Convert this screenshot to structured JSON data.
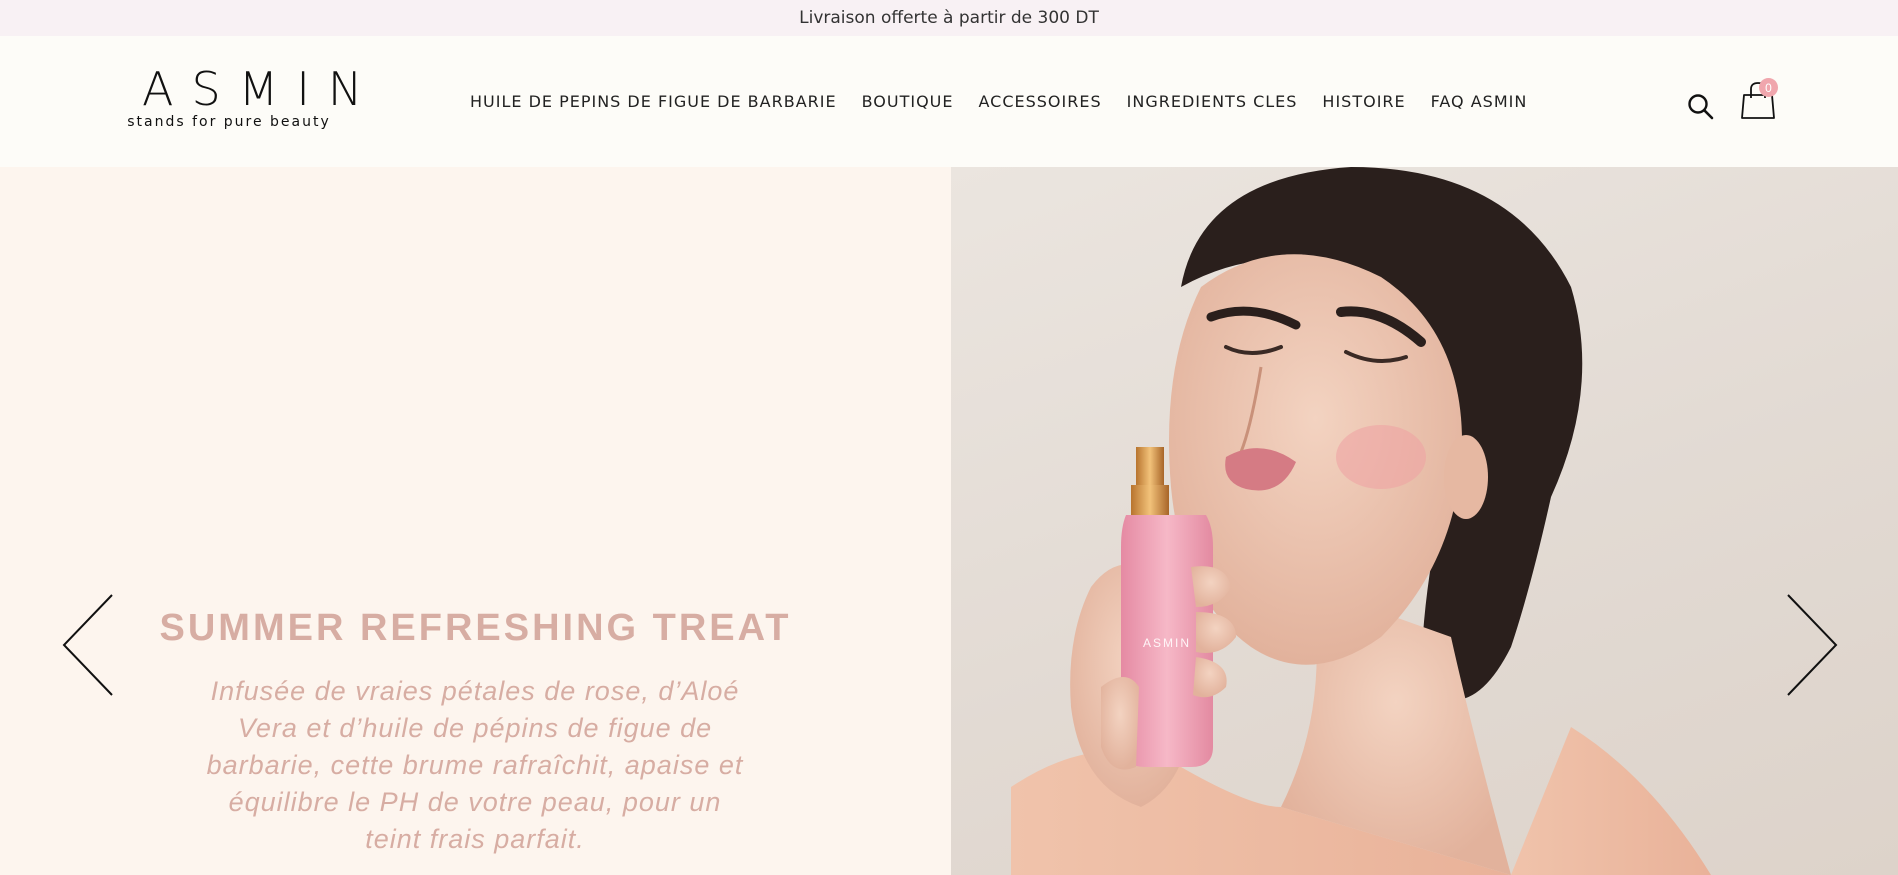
{
  "announcement": {
    "text": "Livraison offerte à partir de 300 DT"
  },
  "header": {
    "logo": {
      "word": "ASMIN",
      "tagline": "stands for pure beauty"
    },
    "nav": [
      {
        "label": "HUILE DE PEPINS DE FIGUE DE BARBARIE"
      },
      {
        "label": "BOUTIQUE"
      },
      {
        "label": "ACCESSOIRES"
      },
      {
        "label": "INGREDIENTS CLES"
      },
      {
        "label": "HISTOIRE"
      },
      {
        "label": "FAQ ASMIN"
      }
    ],
    "search_icon": "search-icon",
    "cart": {
      "icon": "shopping-bag-icon",
      "count": "0"
    }
  },
  "hero": {
    "title": "SUMMER REFRESHING TREAT",
    "text": "Infusée de vraies pétales de rose, d’Aloé Vera et d’huile de pépins de figue de barbarie, cette brume rafraîchit, apaise et équilibre le PH de votre peau, pour un teint frais parfait.",
    "bottle_label": "ASMIN",
    "prev_icon": "chevron-left-icon",
    "next_icon": "chevron-right-icon"
  },
  "colors": {
    "announcement_bg": "#f8f1f4",
    "hero_left_bg": "#fdf5ee",
    "hero_text": "#d7ada3",
    "cart_badge": "#f0a6ad"
  }
}
